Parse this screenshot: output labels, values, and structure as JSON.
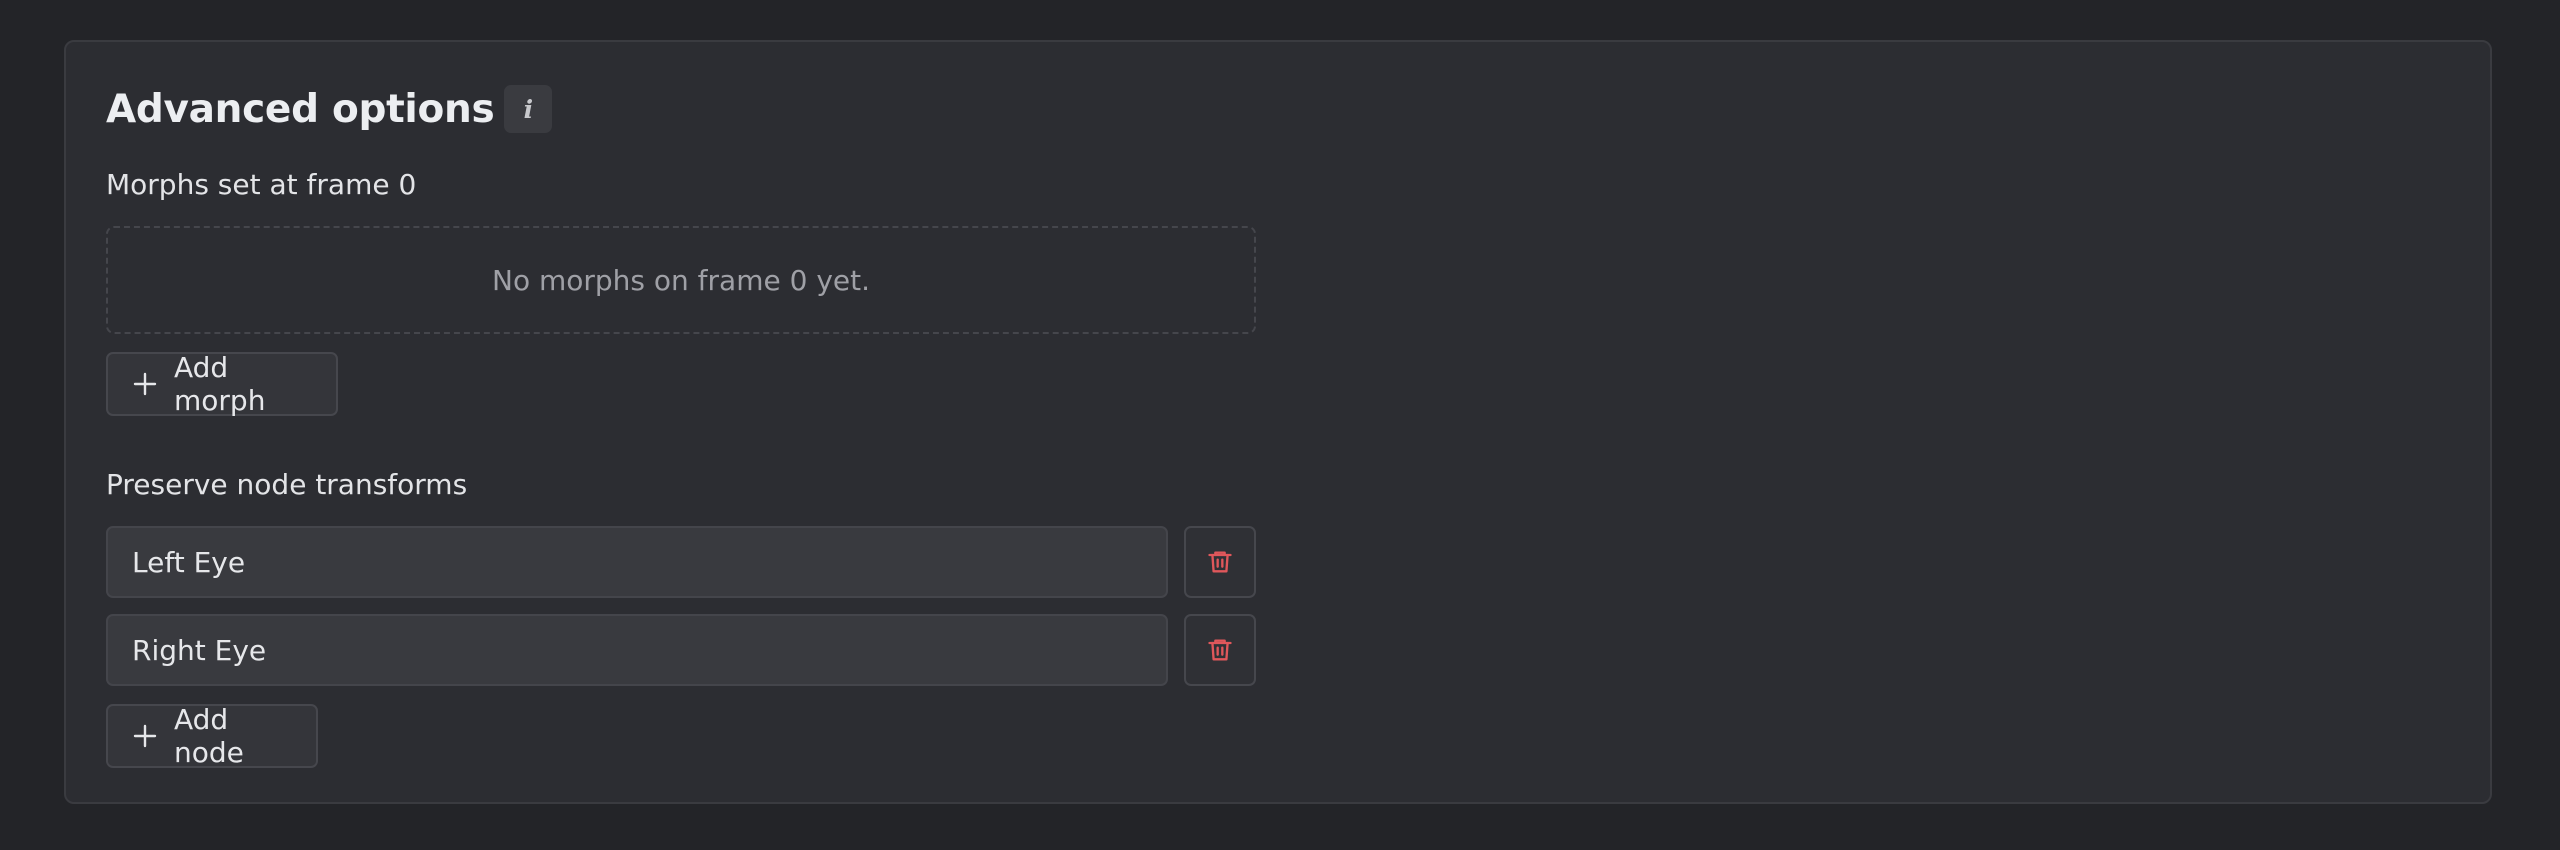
{
  "panel": {
    "title": "Advanced options",
    "info_icon": "info-icon",
    "info_glyph": "i"
  },
  "morphs": {
    "label": "Morphs set at frame 0",
    "empty_text": "No morphs on frame 0 yet.",
    "add_label": "Add morph",
    "add_icon": "plus-icon"
  },
  "nodes": {
    "label": "Preserve node transforms",
    "items": [
      {
        "value": "Left Eye",
        "delete_icon": "trash-icon"
      },
      {
        "value": "Right Eye",
        "delete_icon": "trash-icon"
      }
    ],
    "add_label": "Add node",
    "add_icon": "plus-icon"
  },
  "colors": {
    "background": "#232428",
    "panel": "#2c2d32",
    "danger": "#e0575b"
  }
}
